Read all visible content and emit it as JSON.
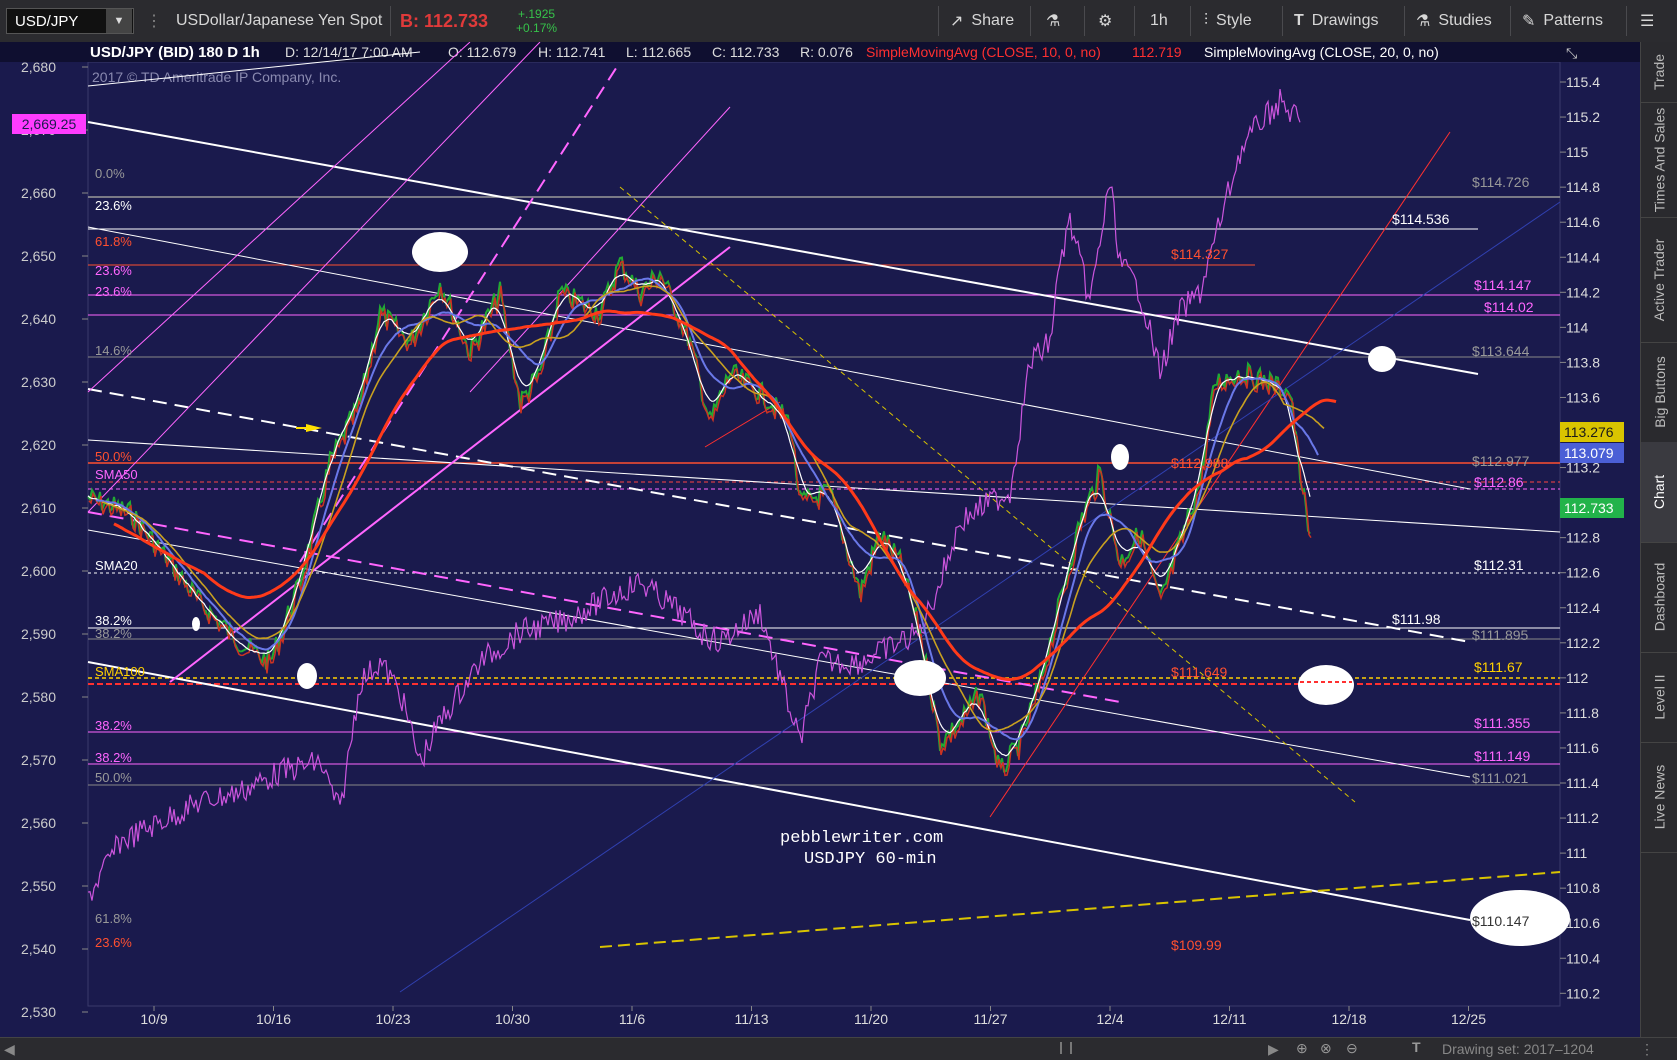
{
  "toolbar": {
    "symbol": "USD/JPY",
    "description": "USDollar/Japanese Yen Spot",
    "bid": "B: 112.733",
    "change_abs": "+.1925",
    "change_pct": "+0.17%",
    "share": "Share",
    "interval": "1h",
    "style": "Style",
    "drawings": "Drawings",
    "studies": "Studies",
    "patterns": "Patterns"
  },
  "header": {
    "title": "USD/JPY (BID) 180 D 1h",
    "date": "D: 12/14/17 7:00 AM",
    "open": "O: 112.679",
    "high": "H: 112.741",
    "low": "L: 112.665",
    "close": "C: 112.733",
    "range": "R: 0.076",
    "study1": "SimpleMovingAvg (CLOSE, 10, 0, no)",
    "study1_value": "112.719",
    "study2": "SimpleMovingAvg (CLOSE, 20, 0, no)",
    "copyright": "2017 © TD Ameritrade IP Company, Inc."
  },
  "watermark": {
    "line1": "pebblewriter.com",
    "line2": "USDJPY 60-min"
  },
  "left_axis": {
    "ticks": [
      "2,680",
      "2,670",
      "2,660",
      "2,650",
      "2,640",
      "2,630",
      "2,620",
      "2,610",
      "2,600",
      "2,590",
      "2,580",
      "2,570",
      "2,560",
      "2,550",
      "2,540",
      "2,530"
    ],
    "badge": "2,669.25"
  },
  "right_axis": {
    "ticks": [
      "115.4",
      "115.2",
      "115",
      "114.8",
      "114.6",
      "114.4",
      "114.2",
      "114",
      "113.8",
      "113.6",
      "113.4",
      "113.2",
      "113",
      "112.8",
      "112.6",
      "112.4",
      "112.2",
      "112",
      "111.8",
      "111.6",
      "111.4",
      "111.2",
      "111",
      "110.8",
      "110.6",
      "110.4",
      "110.2"
    ]
  },
  "x_axis": {
    "labels": [
      "10/9",
      "10/16",
      "10/23",
      "10/30",
      "11/6",
      "11/13",
      "11/20",
      "11/27",
      "12/4",
      "12/11",
      "12/18",
      "12/25"
    ]
  },
  "price_badges": [
    {
      "text": "113.276",
      "color": "#d9c400",
      "fg": "#1a1a1a"
    },
    {
      "text": "113.079",
      "color": "#4b5fd6",
      "fg": "#ffffff"
    },
    {
      "text": "112.733",
      "color": "#22b34a",
      "fg": "#ffffff"
    }
  ],
  "left_labels": {
    "fib0": "0.0%",
    "fib236a": "23.6%",
    "fib618": "61.8%",
    "fib236b": "23.6%",
    "fib236c": "23.6%",
    "fib146": "14.6%",
    "fib500a": "50.0%",
    "sma50": "SMA50",
    "sma20": "SMA20",
    "fib382a": "38.2%",
    "fib382b": "38.2%",
    "sma100": "SMA100",
    "fib382c": "38.2%",
    "fib382d": "38.2%",
    "fib500b": "50.0%",
    "fib618b": "61.8%",
    "fib236d": "23.6%"
  },
  "right_labels": {
    "l1": "$114.726",
    "l2": "$114.536",
    "l3": "$114.327",
    "l4": "$114.147",
    "l5": "$114.02",
    "l6": "$113.644",
    "l7": "$112.977",
    "l8": "$112.988",
    "l9": "$112.86",
    "l10": "$112.31",
    "l11": "$111.98",
    "l12": "$111.895",
    "l13": "$111.649",
    "l14": "$111.67",
    "l15": "$111.355",
    "l16": "$111.149",
    "l17": "$111.021",
    "l18": "$110.147",
    "l19": "$109.99"
  },
  "side_tabs": [
    "Trade",
    "Times And Sales",
    "Active Trader",
    "Big Buttons",
    "Chart",
    "Dashboard",
    "Level II",
    "Live News"
  ],
  "bottom": {
    "drawing_set": "Drawing set: 2017–1204"
  }
}
